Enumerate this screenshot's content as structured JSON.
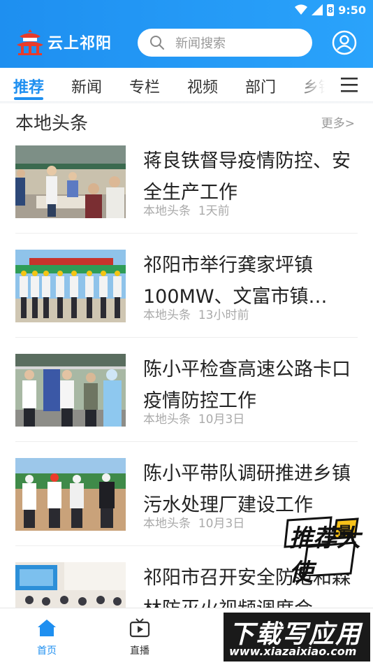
{
  "status_bar": {
    "time": "9:50",
    "battery": "8"
  },
  "header": {
    "logo_text": "云上祁阳",
    "search_placeholder": "新闻搜索"
  },
  "tabs": [
    {
      "label": "推荐",
      "active": true
    },
    {
      "label": "新闻"
    },
    {
      "label": "专栏"
    },
    {
      "label": "视频"
    },
    {
      "label": "部门"
    },
    {
      "label": "乡镇"
    }
  ],
  "section": {
    "title": "本地头条",
    "more": "更多>"
  },
  "news": [
    {
      "title": "蒋良铁督导疫情防控、安全生产工作",
      "source": "本地头条",
      "time": "1天前"
    },
    {
      "title": "祁阳市举行龚家坪镇100MW、文富市镇…",
      "source": "本地头条",
      "time": "13小时前"
    },
    {
      "title": "陈小平检查高速公路卡口疫情防控工作",
      "source": "本地头条",
      "time": "10月3日"
    },
    {
      "title": "陈小平带队调研推进乡镇污水处理厂建设工作",
      "source": "本地头条",
      "time": "10月3日"
    },
    {
      "title": "祁阳市召开安全防范和森林防灭火视频调度会",
      "source": "",
      "time": ""
    }
  ],
  "bottom_nav": [
    {
      "label": "首页",
      "active": true
    },
    {
      "label": "直播"
    }
  ],
  "watermark": {
    "badge": "推荐大使",
    "badge_small": "最",
    "site_name": "下载写应用",
    "site_url": "www.xiazaixiao.com"
  },
  "colors": {
    "accent": "#1e8ff0",
    "header_start": "#1e8ff0",
    "header_end": "#2aa3fb"
  }
}
